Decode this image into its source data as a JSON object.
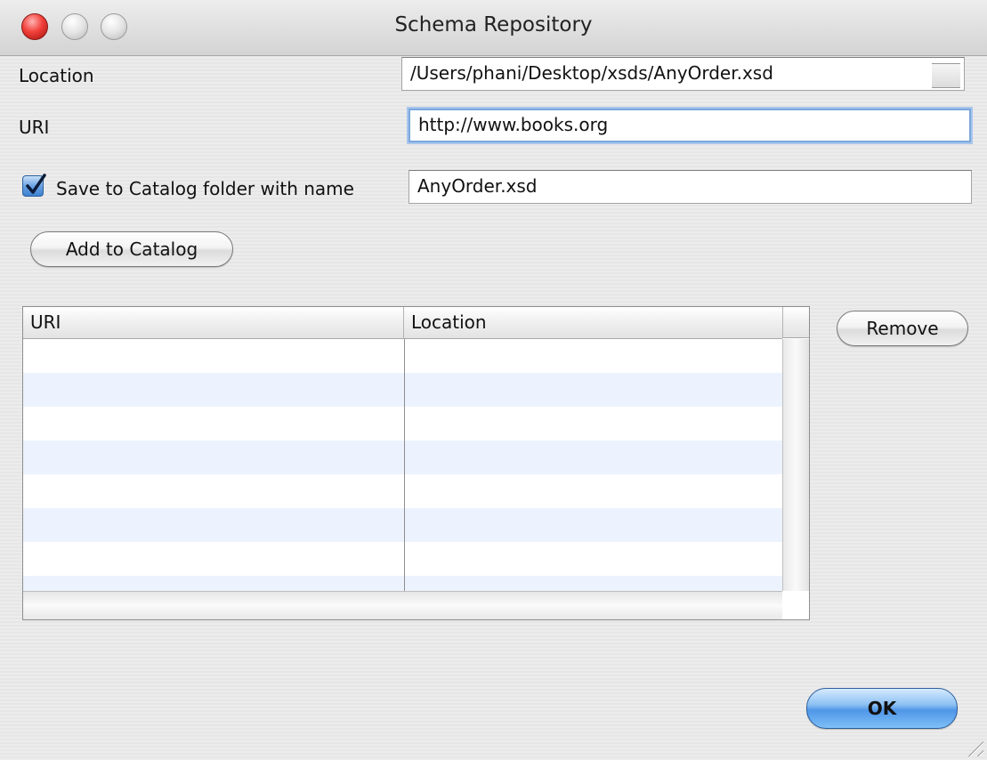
{
  "window": {
    "title": "Schema Repository"
  },
  "form": {
    "location_label": "Location",
    "location_value": "/Users/phani/Desktop/xsds/AnyOrder.xsd",
    "uri_label": "URI",
    "uri_value": "http://www.books.org",
    "save_checkbox_label": "Save to Catalog folder with name",
    "save_checkbox_checked": true,
    "catalog_name_value": "AnyOrder.xsd"
  },
  "buttons": {
    "add_to_catalog": "Add to Catalog",
    "remove": "Remove",
    "ok": "OK"
  },
  "table": {
    "columns": [
      "URI",
      "Location"
    ],
    "rows": []
  },
  "colors": {
    "close_button": "#f2403a",
    "focus_ring": "#7ba8dc",
    "default_button": "#4f96e8",
    "row_alternate": "#edf3fe"
  }
}
